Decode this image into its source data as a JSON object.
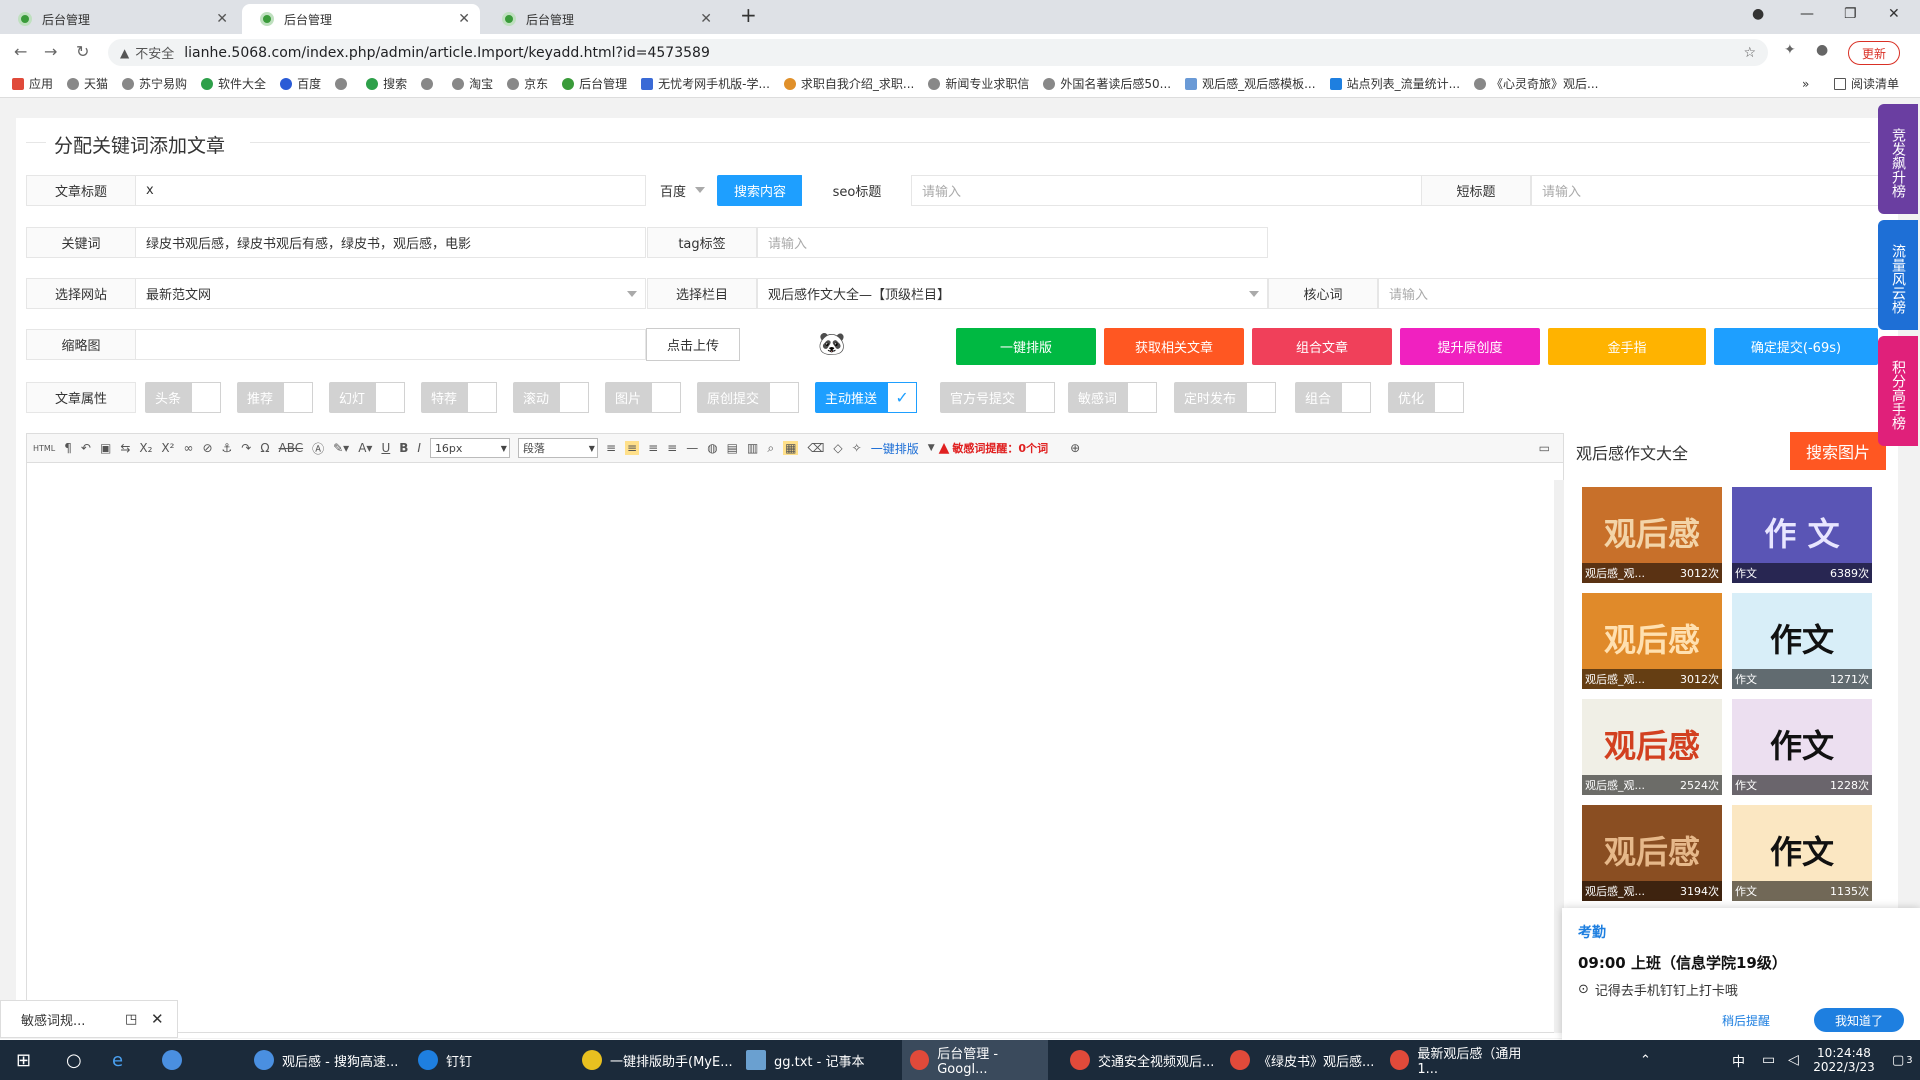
{
  "browser": {
    "tabs": [
      {
        "label": "后台管理",
        "active": false
      },
      {
        "label": "后台管理",
        "active": true
      },
      {
        "label": "后台管理",
        "active": false
      }
    ],
    "security": "不安全",
    "url": "lianhe.5068.com/index.php/admin/article.Import/keyadd.html?id=4573589",
    "update_label": "更新",
    "bookmarks": [
      "应用",
      "天猫",
      "苏宁易购",
      "软件大全",
      "百度",
      "",
      "搜索",
      "",
      "淘宝",
      "京东",
      "后台管理",
      "无忧考网手机版-学...",
      "求职自我介绍_求职...",
      "新闻专业求职信",
      "外国名著读后感50...",
      "观后感_观后感模板...",
      "站点列表_流量统计...",
      "《心灵奇旅》观后..."
    ],
    "reading_list": "阅读清单",
    "more": "»"
  },
  "page": {
    "title": "分配关键词添加文章",
    "form": {
      "article_title_label": "文章标题",
      "article_title_value": "x",
      "engine_value": "百度",
      "search_btn": "搜索内容",
      "seo_label": "seo标题",
      "seo_placeholder": "请输入",
      "short_label": "短标题",
      "short_placeholder": "请输入",
      "keyword_label": "关键词",
      "keyword_value": "绿皮书观后感，绿皮书观后有感，绿皮书，观后感，电影",
      "tag_label": "tag标签",
      "tag_placeholder": "请输入",
      "site_label": "选择网站",
      "site_value": "最新范文网",
      "column_label": "选择栏目",
      "column_value": "观后感作文大全—【顶级栏目】",
      "core_label": "核心词",
      "core_placeholder": "请输入",
      "thumb_label": "缩略图",
      "upload_btn": "点击上传",
      "attr_label": "文章属性"
    },
    "actions": [
      {
        "label": "一键排版",
        "color": "#00b942"
      },
      {
        "label": "获取相关文章",
        "color": "#ff5722"
      },
      {
        "label": "组合文章",
        "color": "#f0405a"
      },
      {
        "label": "提升原创度",
        "color": "#f021c0"
      },
      {
        "label": "金手指",
        "color": "#ffb300"
      },
      {
        "label": "确定提交(-69s)",
        "color": "#1e9fff"
      }
    ],
    "attributes": [
      {
        "label": "头条",
        "on": false
      },
      {
        "label": "推荐",
        "on": false
      },
      {
        "label": "幻灯",
        "on": false
      },
      {
        "label": "特荐",
        "on": false
      },
      {
        "label": "滚动",
        "on": false
      },
      {
        "label": "图片",
        "on": false
      },
      {
        "label": "原创提交",
        "on": false
      },
      {
        "label": "主动推送",
        "on": true
      },
      {
        "label": "官方号提交",
        "on": false
      },
      {
        "label": "敏感词",
        "on": false
      },
      {
        "label": "定时发布",
        "on": false
      },
      {
        "label": "组合",
        "on": false
      },
      {
        "label": "优化",
        "on": false
      }
    ],
    "check_mark": "✓",
    "editor": {
      "font_size": "16px",
      "paragraph": "段落",
      "one_click": "一键排版",
      "sensitive_label": "敏感词提醒：",
      "sensitive_count": "0个词"
    }
  },
  "right_panel": {
    "title": "观后感作文大全",
    "search_btn": "搜索图片",
    "images": [
      {
        "big": "观后感",
        "name": "观后感_观...",
        "count": "3012次",
        "bg": "#c8702a",
        "fg": "#f3d4a8"
      },
      {
        "big": "作 文",
        "name": "作文",
        "count": "6389次",
        "bg": "#5a55b5",
        "fg": "#e8e6ff"
      },
      {
        "big": "观后感",
        "name": "观后感_观...",
        "count": "3012次",
        "bg": "#e08a2a",
        "fg": "#ffe0b0"
      },
      {
        "big": "作文",
        "name": "作文",
        "count": "1271次",
        "bg": "#d8eef8",
        "fg": "#111"
      },
      {
        "big": "观后感",
        "name": "观后感_观...",
        "count": "2524次",
        "bg": "#f0efe6",
        "fg": "#d24020"
      },
      {
        "big": "作文",
        "name": "作文",
        "count": "1228次",
        "bg": "#ecdff0",
        "fg": "#111"
      },
      {
        "big": "观后感",
        "name": "观后感_观...",
        "count": "3194次",
        "bg": "#8a4e22",
        "fg": "#e6b88a"
      },
      {
        "big": "作文",
        "name": "作文",
        "count": "1135次",
        "bg": "#fbe7c2",
        "fg": "#111"
      }
    ]
  },
  "side_tabs": [
    {
      "label": "竞发飙升榜",
      "color": "#6a3ea1"
    },
    {
      "label": "流量风云榜",
      "color": "#1e6fd6"
    },
    {
      "label": "积分高手榜",
      "color": "#e0207a"
    }
  ],
  "dingtalk": {
    "title": "考勤",
    "event": "09:00 上班（信息学院19级）",
    "note": "记得去手机钉钉上打卡哦",
    "later": "稍后提醒",
    "know": "我知道了"
  },
  "sensitive_popup": {
    "label": "敏感词规..."
  },
  "taskbar": {
    "items": [
      {
        "label": "观后感 - 搜狗高速...",
        "color": "#4a8fe0"
      },
      {
        "label": "钉钉",
        "color": "#1e7fe0"
      },
      {
        "label": "一键排版助手(MyE...",
        "color": "#e8c020"
      },
      {
        "label": "gg.txt - 记事本",
        "color": "#6aa0d0"
      },
      {
        "label": "后台管理 - Googl...",
        "color": "#e04a3a"
      },
      {
        "label": "交通安全视频观后...",
        "color": "#e04a3a"
      },
      {
        "label": "《绿皮书》观后感...",
        "color": "#e04a3a"
      },
      {
        "label": "最新观后感（通用1...",
        "color": "#e04a3a"
      }
    ],
    "time": "10:24:48",
    "date": "2022/3/23",
    "ime": "中",
    "notif": "3"
  }
}
